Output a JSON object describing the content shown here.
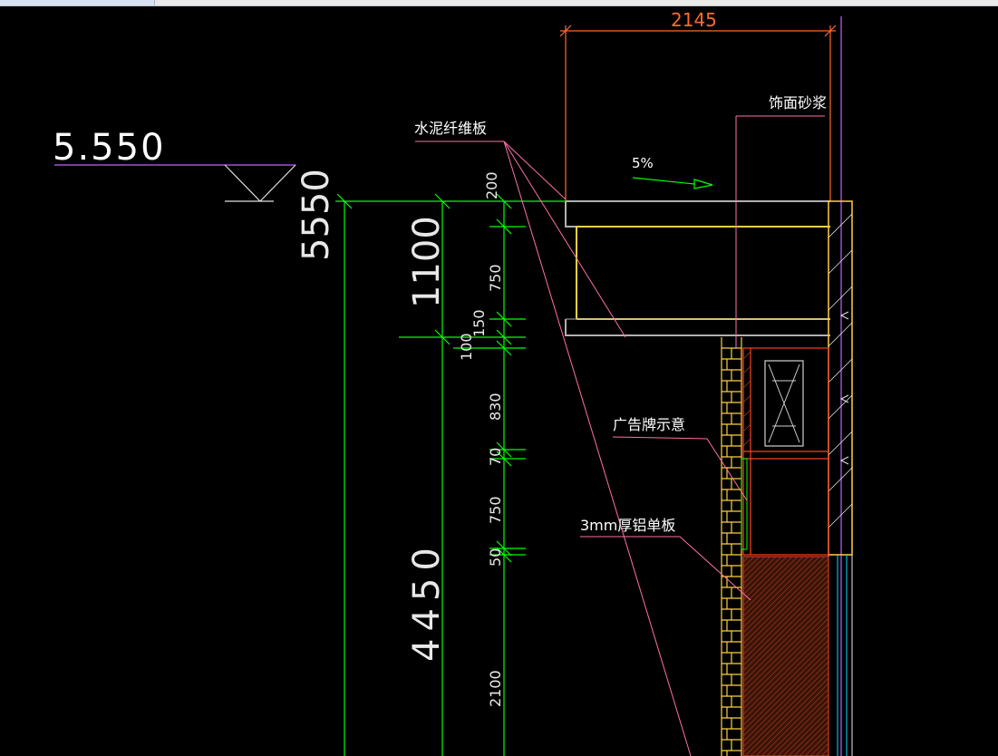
{
  "ui": {
    "elevation_value": "5.550",
    "labels": {
      "cement_board": "水泥纤维板",
      "finish_mortar": "饰面砂浆",
      "slope": "5%",
      "billboard": "广告牌示意",
      "aluminum_panel": "3mm厚铝单板"
    },
    "dims": {
      "top_width": "2145",
      "total_height": "5550",
      "upper_height": "1100",
      "lower_height": "4450",
      "seg_200": "200",
      "seg_750a": "750",
      "seg_150": "150",
      "seg_100": "100",
      "seg_830": "830",
      "seg_70": "70",
      "seg_750b": "750",
      "seg_50": "50",
      "seg_2100": "2100"
    },
    "colors": {
      "background": "#000000",
      "dimension_green": "#00ff00",
      "dimension_orange": "#ff6a2a",
      "leader_pink": "#ff6fa8",
      "yellow": "#ffd040",
      "grey": "#b0b0b0",
      "magenta": "#c060ff",
      "brick": "#ff4020",
      "cyan": "#00e0ff"
    }
  }
}
